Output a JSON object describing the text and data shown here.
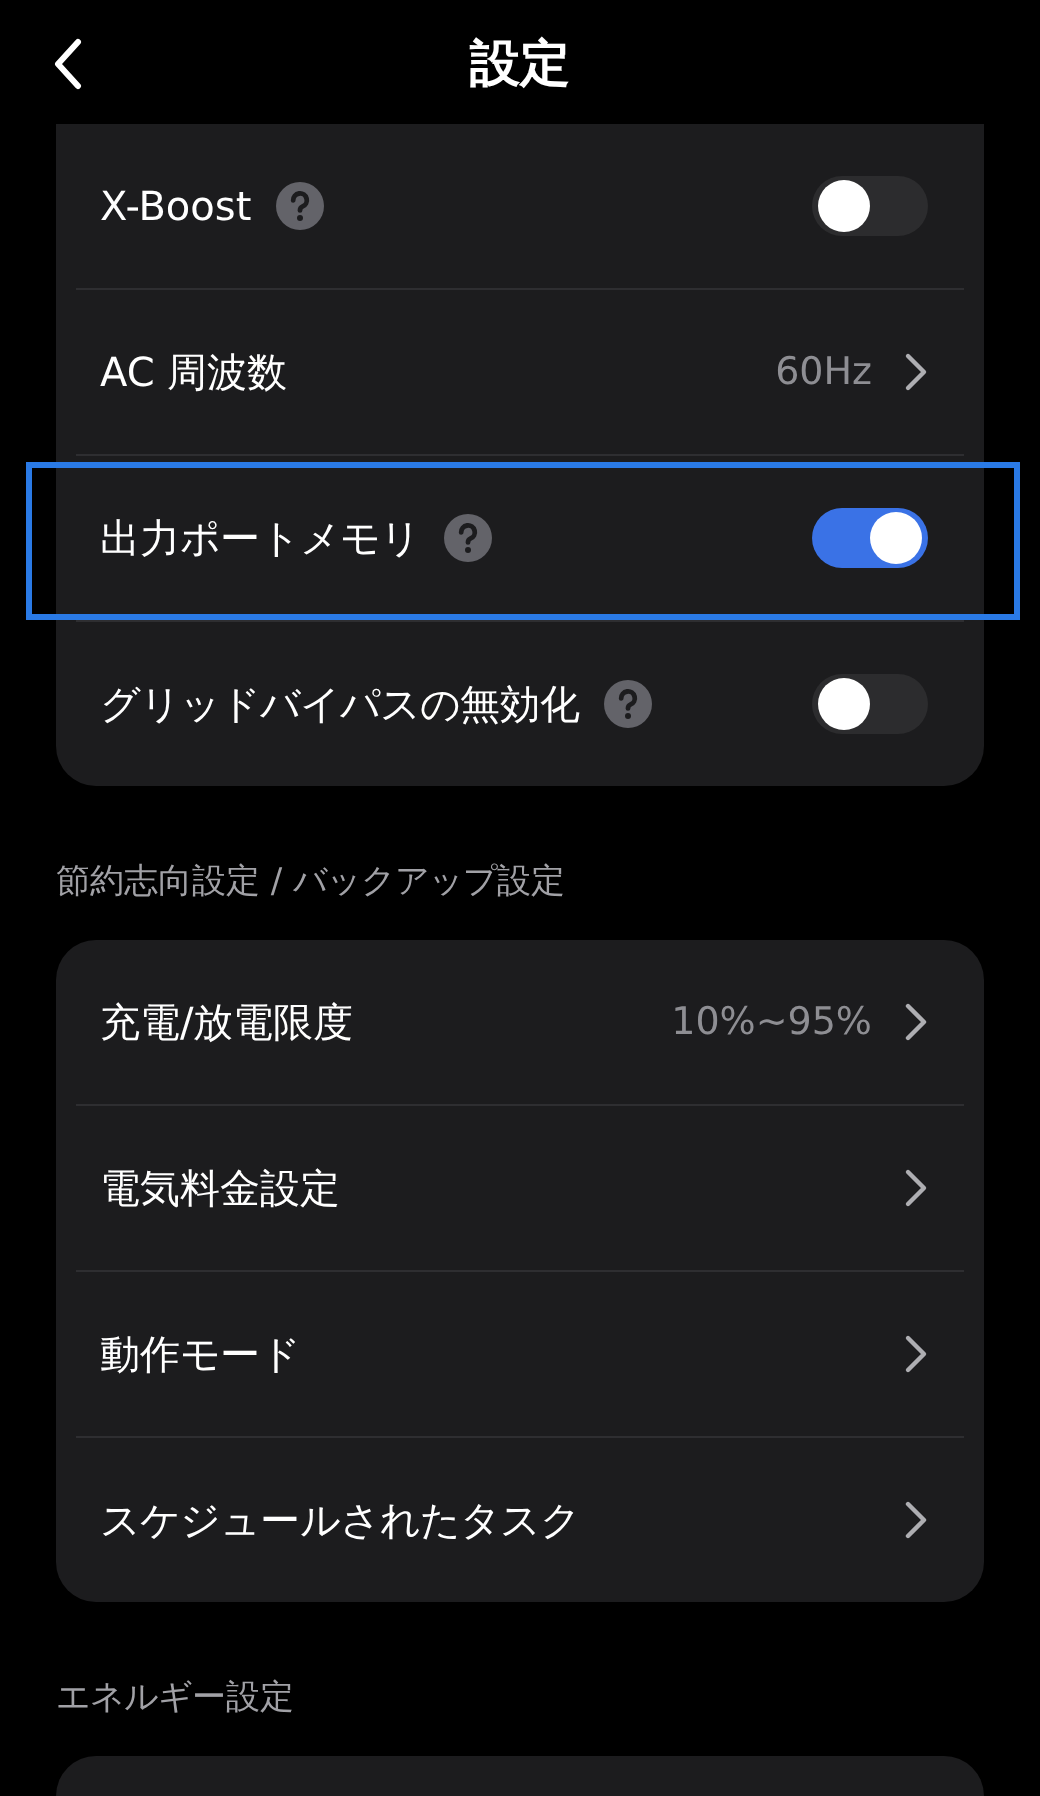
{
  "header": {
    "title": "設定"
  },
  "sections": [
    {
      "items": [
        {
          "kind": "toggle",
          "label": "X-Boost",
          "help": true,
          "on": false
        },
        {
          "kind": "link",
          "label": "AC 周波数",
          "value": "60Hz"
        },
        {
          "kind": "toggle",
          "label": "出力ポートメモリ",
          "help": true,
          "on": true,
          "highlighted": true
        },
        {
          "kind": "toggle",
          "label": "グリッドバイパスの無効化",
          "help": true,
          "on": false
        }
      ]
    },
    {
      "title": "節約志向設定 / バックアップ設定",
      "items": [
        {
          "kind": "link",
          "label": "充電/放電限度",
          "value": "10%~95%"
        },
        {
          "kind": "link",
          "label": "電気料金設定"
        },
        {
          "kind": "link",
          "label": "動作モード"
        },
        {
          "kind": "link",
          "label": "スケジュールされたタスク"
        }
      ]
    },
    {
      "title": "エネルギー設定"
    }
  ]
}
